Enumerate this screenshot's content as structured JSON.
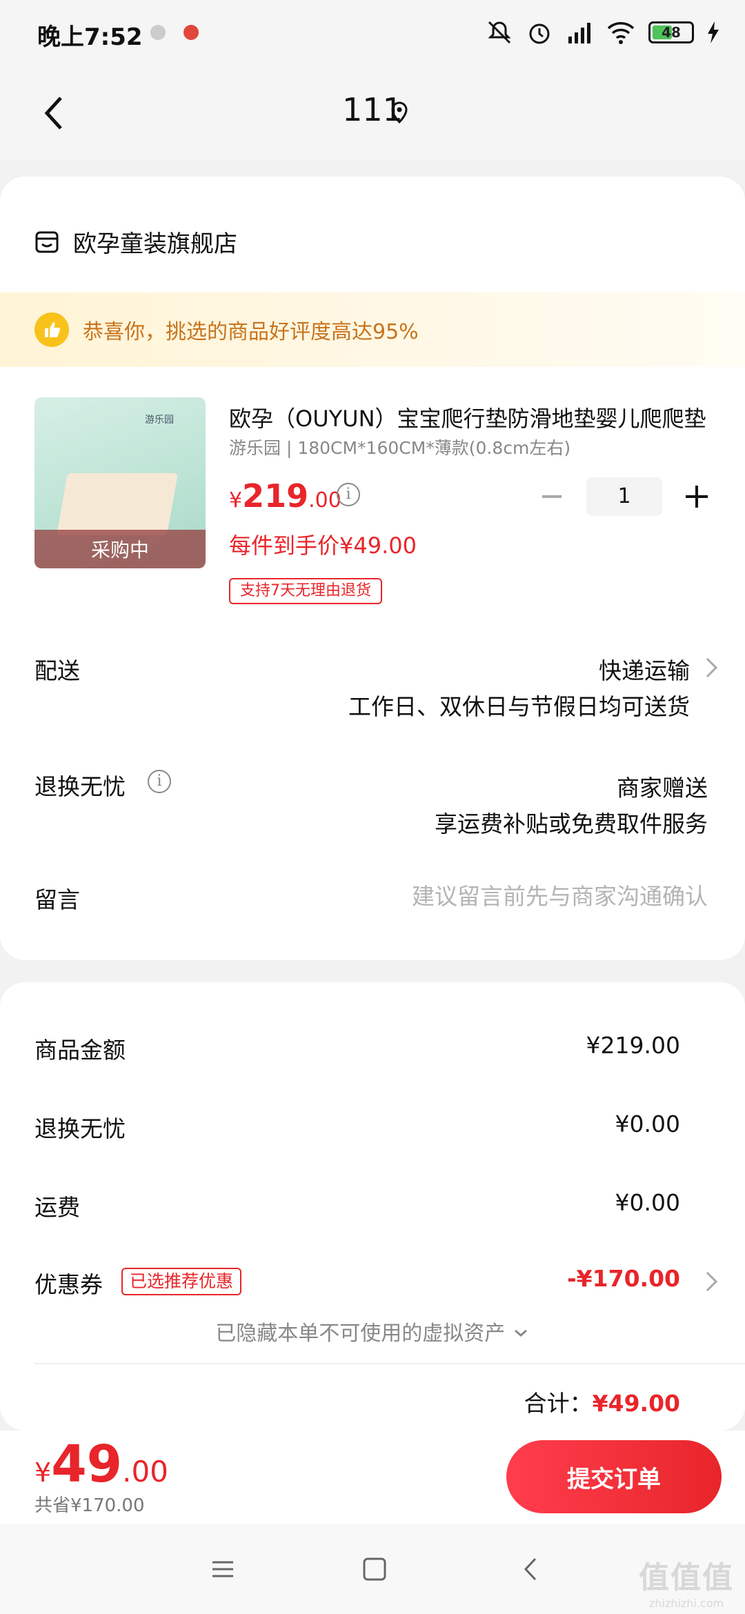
{
  "status_bar": {
    "time": "晚上7:52",
    "battery": "48",
    "icons": [
      "mute-icon",
      "alarm-icon",
      "signal-icon",
      "wifi-icon",
      "battery-icon",
      "charging-icon"
    ]
  },
  "nav": {
    "title": "111",
    "back_icon": "back-chevron-icon",
    "location_icon": "location-pin-icon"
  },
  "shop": {
    "name": "欧孕童装旗舰店",
    "icon": "shop-icon"
  },
  "promo": {
    "text": "恭喜你，挑选的商品好评度高达95%",
    "icon": "thumbs-up-icon"
  },
  "product": {
    "title": "欧孕（OUYUN）宝宝爬行垫防滑地垫婴儿爬爬垫",
    "spec": "游乐园 | 180CM*160CM*薄款(0.8cm左右)",
    "image_overlay": "采购中",
    "image_brand": "游乐园",
    "price_currency": "¥",
    "price_int": "219",
    "price_dec": ".00",
    "net_price": "每件到手价¥49.00",
    "return_tag": "支持7天无理由退货",
    "quantity": "1"
  },
  "delivery": {
    "label": "配送",
    "value": "快递运输",
    "sub": "工作日、双休日与节假日均可送货"
  },
  "return_service": {
    "label": "退换无忧",
    "value": "商家赠送",
    "sub": "享运费补贴或免费取件服务"
  },
  "message": {
    "label": "留言",
    "placeholder": "建议留言前先与商家沟通确认"
  },
  "summary": {
    "goods_label": "商品金额",
    "goods_value": "¥219.00",
    "return_label": "退换无忧",
    "return_value": "¥0.00",
    "shipping_label": "运费",
    "shipping_value": "¥0.00",
    "coupon_label": "优惠券",
    "coupon_tag": "已选推荐优惠",
    "coupon_value": "-¥170.00",
    "hidden_note": "已隐藏本单不可使用的虚拟资产",
    "subtotal_label": "合计：",
    "subtotal_value": "¥49.00"
  },
  "bottom": {
    "currency": "¥",
    "total_int": "49",
    "total_dec": ".00",
    "saved": "共省¥170.00",
    "submit_label": "提交订单"
  },
  "watermark": {
    "big": "值值值",
    "small": "zhizhizhi.com"
  },
  "colors": {
    "accent": "#e8252a",
    "promo_text": "#c8731b",
    "promo_bg": "#fff4d6",
    "background": "#f2f2f2"
  }
}
